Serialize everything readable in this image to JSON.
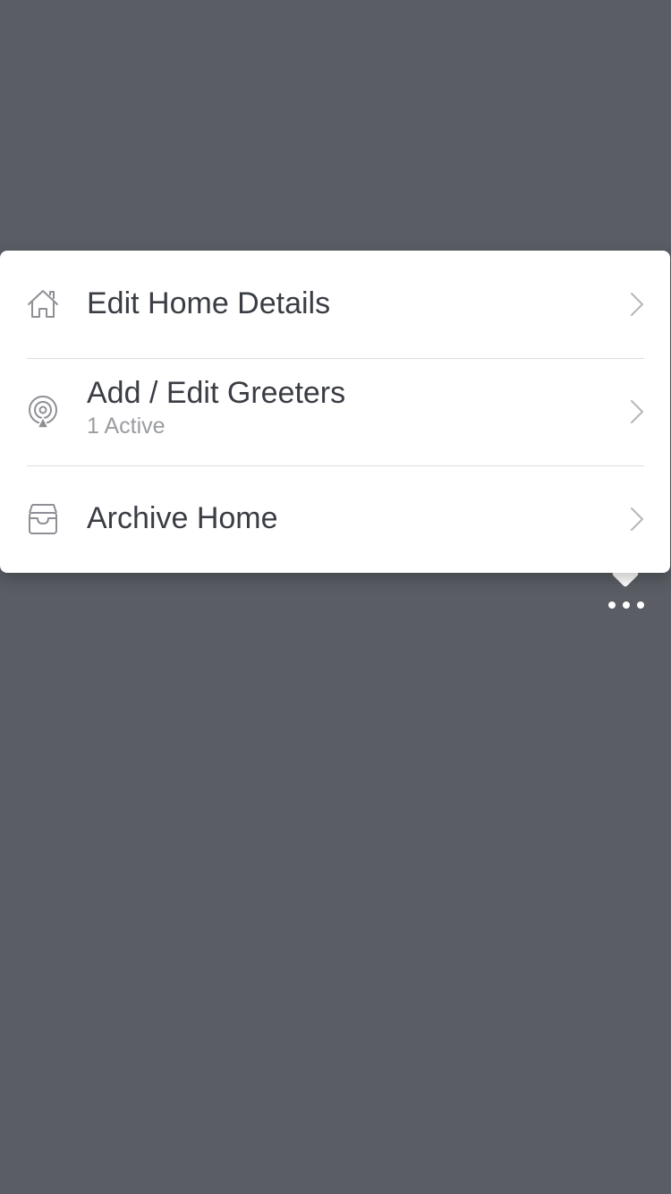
{
  "menu": {
    "items": [
      {
        "label": "Edit Home Details",
        "icon": "home-icon"
      },
      {
        "label": "Add / Edit Greeters",
        "sublabel": "1 Active",
        "icon": "greeter-beacon-icon"
      },
      {
        "label": "Archive Home",
        "icon": "archive-box-icon"
      }
    ]
  },
  "more_button": {
    "icon": "more-dots-icon"
  },
  "colors": {
    "backdrop": "#5a5d64",
    "card": "#ffffff",
    "text_primary": "#3a3d44",
    "text_secondary": "#9a9ca2",
    "icon": "#8e9096"
  }
}
